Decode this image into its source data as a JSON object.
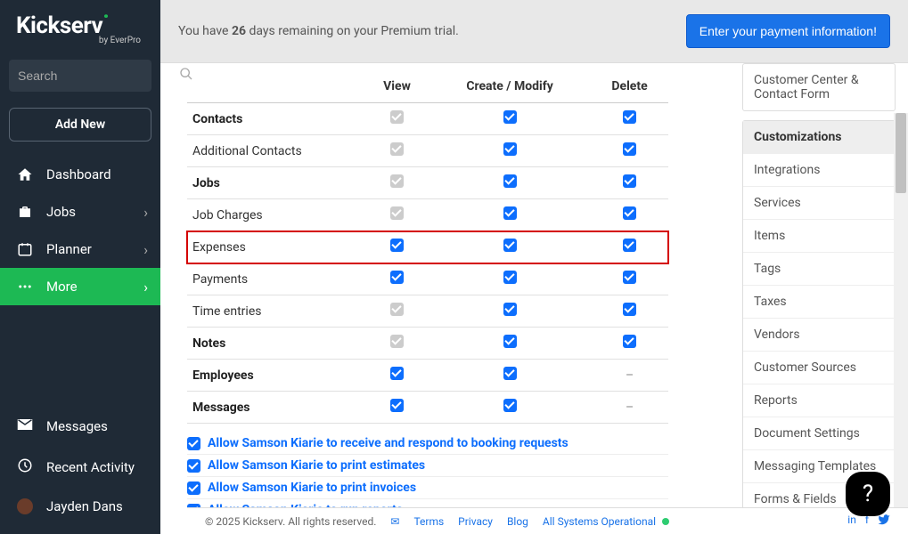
{
  "sidebar": {
    "logo": "Kickserv",
    "logo_sub": "by EverPro",
    "search_placeholder": "Search",
    "add_new": "Add New",
    "nav": [
      {
        "label": "Dashboard",
        "icon": "home",
        "chev": false,
        "active": false
      },
      {
        "label": "Jobs",
        "icon": "briefcase",
        "chev": true,
        "active": false
      },
      {
        "label": "Planner",
        "icon": "calendar",
        "chev": true,
        "active": false
      },
      {
        "label": "More",
        "icon": "dots",
        "chev": true,
        "active": true
      }
    ],
    "bottom": [
      {
        "label": "Messages",
        "icon": "mail"
      },
      {
        "label": "Recent Activity",
        "icon": "clock"
      },
      {
        "label": "Jayden Dans",
        "icon": "avatar"
      }
    ]
  },
  "banner": {
    "prefix": "You have ",
    "days": "26",
    "suffix": " days remaining on your Premium trial.",
    "cta": "Enter your payment information!"
  },
  "table": {
    "headers": [
      "",
      "View",
      "Create / Modify",
      "Delete"
    ],
    "rows": [
      {
        "label": "Contacts",
        "bold": true,
        "cells": [
          "disabled",
          "checked",
          "checked"
        ]
      },
      {
        "label": "Additional Contacts",
        "bold": false,
        "cells": [
          "disabled",
          "checked",
          "checked"
        ]
      },
      {
        "label": "Jobs",
        "bold": true,
        "cells": [
          "disabled",
          "checked",
          "checked"
        ]
      },
      {
        "label": "Job Charges",
        "bold": false,
        "cells": [
          "disabled",
          "checked",
          "checked"
        ]
      },
      {
        "label": "Expenses",
        "bold": false,
        "cells": [
          "checked",
          "checked",
          "checked"
        ],
        "highlight": true
      },
      {
        "label": "Payments",
        "bold": false,
        "cells": [
          "checked",
          "checked",
          "checked"
        ]
      },
      {
        "label": "Time entries",
        "bold": false,
        "cells": [
          "disabled",
          "checked",
          "checked"
        ]
      },
      {
        "label": "Notes",
        "bold": true,
        "cells": [
          "disabled",
          "checked",
          "checked"
        ]
      },
      {
        "label": "Employees",
        "bold": true,
        "cells": [
          "checked",
          "checked",
          "dash"
        ]
      },
      {
        "label": "Messages",
        "bold": true,
        "cells": [
          "checked",
          "checked",
          "dash"
        ]
      }
    ]
  },
  "allows": [
    "Allow Samson Kiarie to receive and respond to booking requests",
    "Allow Samson Kiarie to print estimates",
    "Allow Samson Kiarie to print invoices",
    "Allow Samson Kiarie to run reports"
  ],
  "right": {
    "top": [
      "Customer Center & Contact Form"
    ],
    "header": "Customizations",
    "items": [
      "Integrations",
      "Services",
      "Items",
      "Tags",
      "Taxes",
      "Vendors",
      "Customer Sources",
      "Reports",
      "Document Settings",
      "Messaging Templates",
      "Forms & Fields"
    ]
  },
  "footer": {
    "copyright": "© 2025 Kickserv. All rights reserved.",
    "links": [
      "Terms",
      "Privacy",
      "Blog",
      "All Systems Operational"
    ]
  }
}
